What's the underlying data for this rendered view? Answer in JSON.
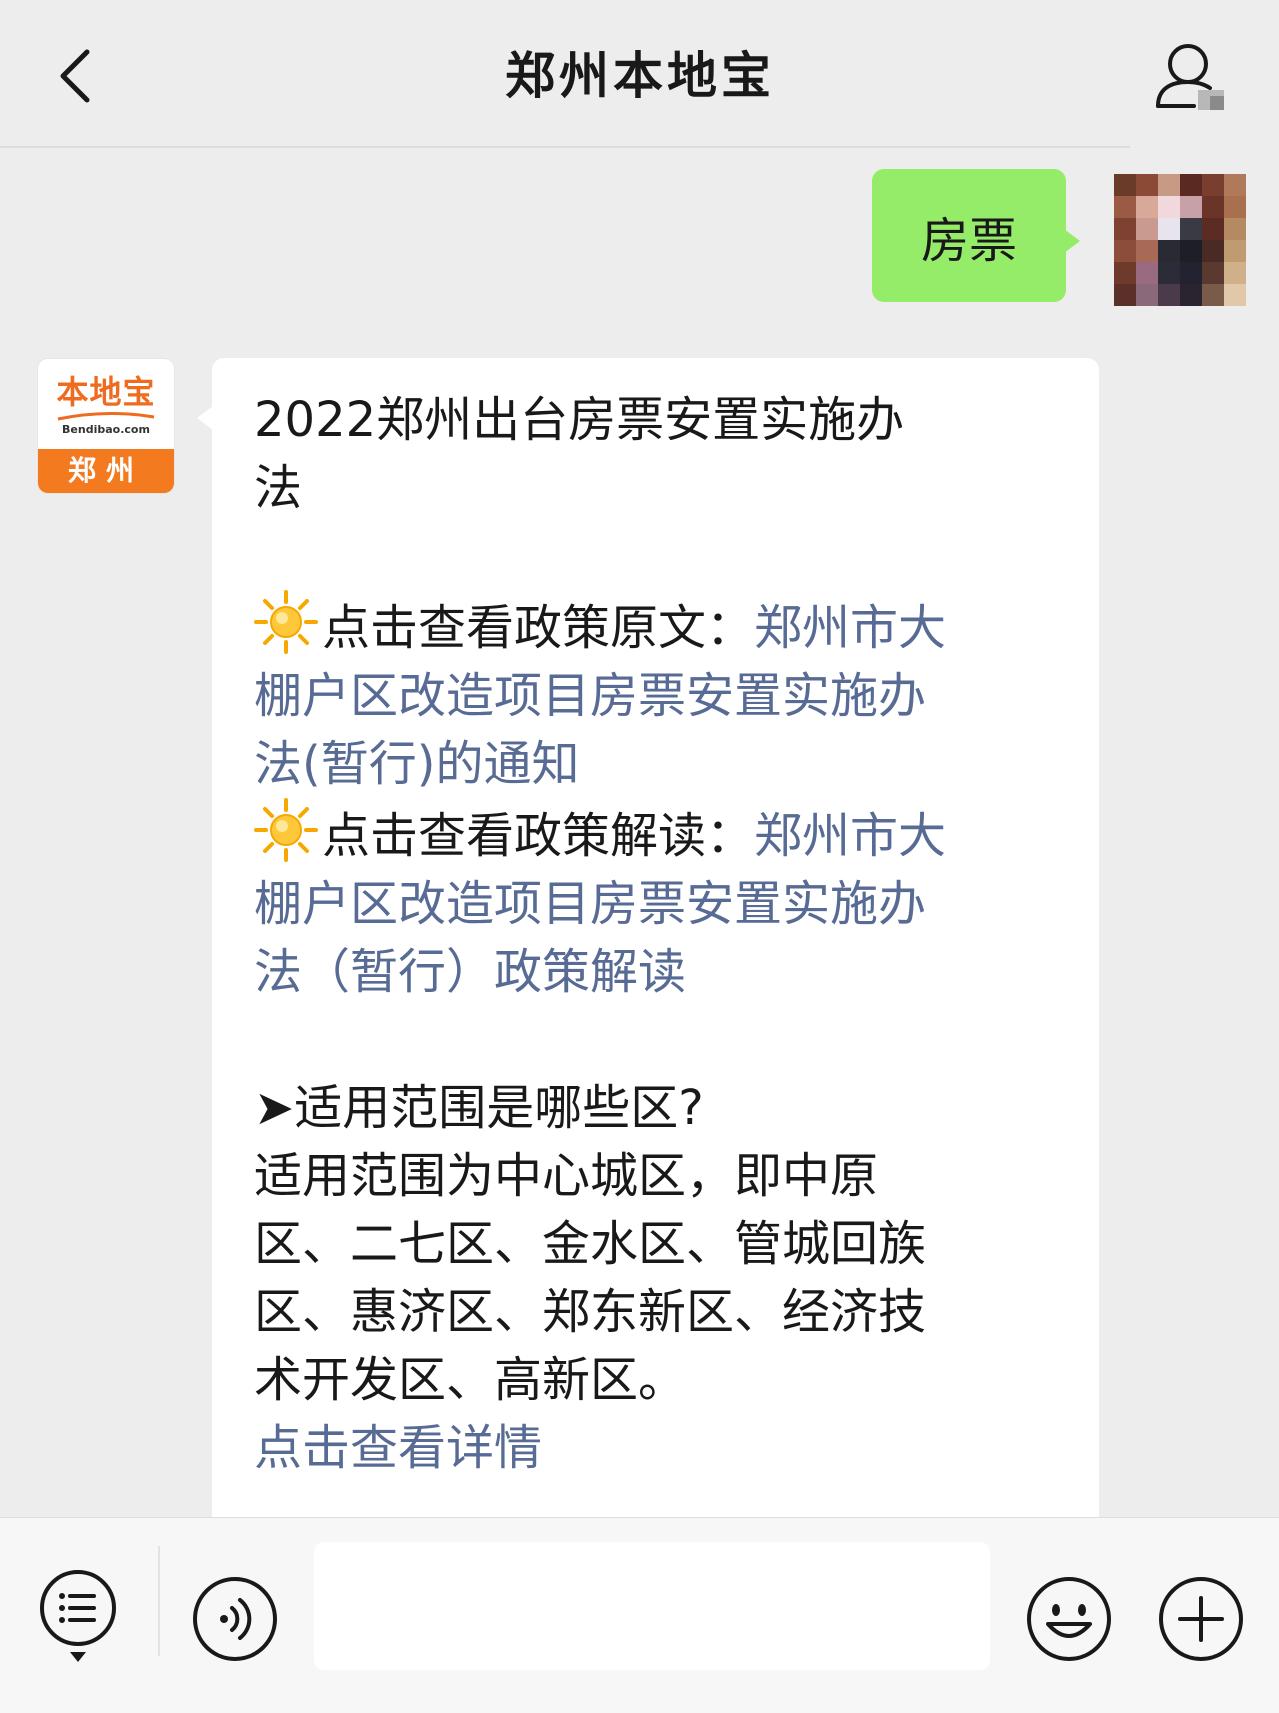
{
  "header": {
    "title": "郑州本地宝",
    "back_icon": "chevron-left-icon",
    "profile_icon": "person-icon"
  },
  "sent_message": {
    "text": "房票",
    "bubble_color": "#95ec69"
  },
  "bot_avatar": {
    "logo_text": "本地宝",
    "domain": "Bendibao.com",
    "city": "郑州",
    "accent_color": "#f47a20"
  },
  "received_message": {
    "title_line1": "2022郑州出台房票安置实施办",
    "title_line2": "法",
    "policy_prefix": "点击查看政策原文：",
    "policy_link_line1": "郑州市大",
    "policy_link_line2": "棚户区改造项目房票安置实施办",
    "policy_link_line3": "法(暂行)的通知",
    "interpret_prefix": "点击查看政策解读：",
    "interpret_link_line1": "郑州市大",
    "interpret_link_line2": "棚户区改造项目房票安置实施办",
    "interpret_link_line3": "法（暂行）政策解读",
    "question": "➤适用范围是哪些区?",
    "answer_line1": "适用范围为中心城区，即中原",
    "answer_line2": "区、二七区、金水区、管城回族",
    "answer_line3": "区、惠济区、郑东新区、经济技",
    "answer_line4": "术开发区、高新区。",
    "details_link": "点击查看详情",
    "link_color": "#576b95",
    "sun_icon": "sun-icon"
  },
  "input_bar": {
    "menu_icon": "menu-list-icon",
    "voice_icon": "voice-icon",
    "text_value": "",
    "emoji_icon": "smiley-icon",
    "plus_icon": "plus-icon"
  }
}
